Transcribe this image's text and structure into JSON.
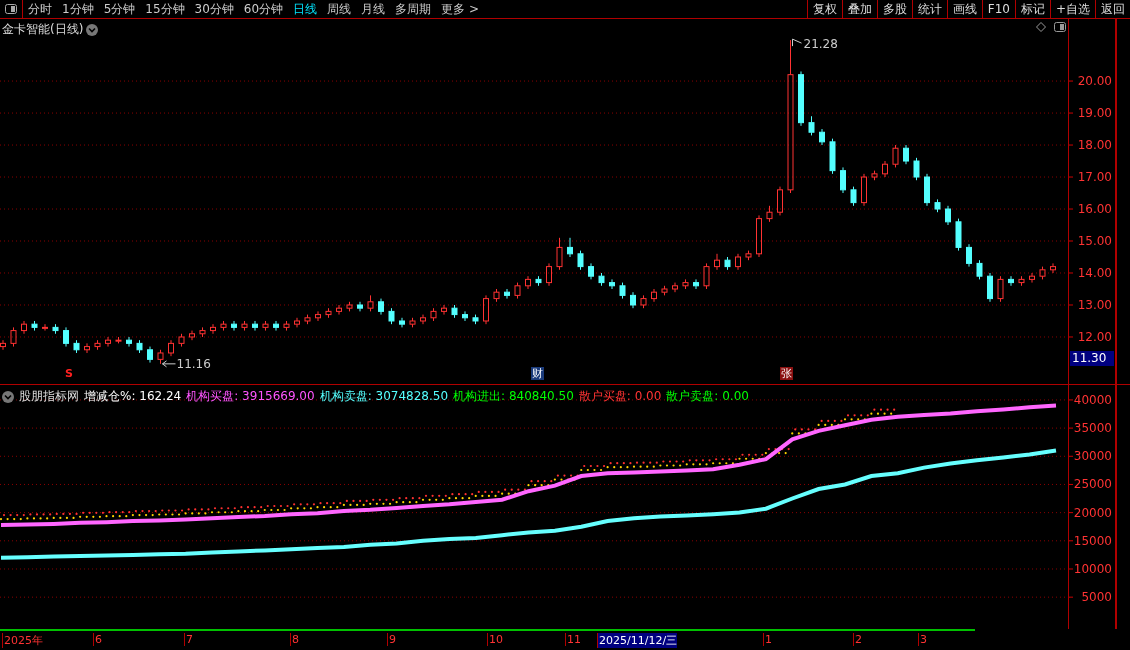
{
  "toolbar": {
    "periods": [
      {
        "label": "分时",
        "selected": false
      },
      {
        "label": "1分钟",
        "selected": false
      },
      {
        "label": "5分钟",
        "selected": false
      },
      {
        "label": "15分钟",
        "selected": false
      },
      {
        "label": "30分钟",
        "selected": false
      },
      {
        "label": "60分钟",
        "selected": false
      },
      {
        "label": "日线",
        "selected": true
      },
      {
        "label": "周线",
        "selected": false
      },
      {
        "label": "月线",
        "selected": false
      },
      {
        "label": "多周期",
        "selected": false
      },
      {
        "label": "更多 >",
        "selected": false
      }
    ],
    "actions": [
      "复权",
      "叠加",
      "多股",
      "统计",
      "画线",
      "F10",
      "标记",
      "+自选",
      "返回"
    ]
  },
  "price_panel": {
    "title": "金卡智能(日线)",
    "high_label": "21.28",
    "low_label": "11.16",
    "chart_data": {
      "type": "candlestick",
      "grid": true,
      "ylim": [
        10.53,
        21.94
      ],
      "yticks": [
        {
          "value": 12,
          "label": "12.00"
        },
        {
          "value": 13,
          "label": "13.00"
        },
        {
          "value": 14,
          "label": "14.00"
        },
        {
          "value": 15,
          "label": "15.00"
        },
        {
          "value": 16,
          "label": "16.00"
        },
        {
          "value": 17,
          "label": "17.00"
        },
        {
          "value": 18,
          "label": "18.00"
        },
        {
          "value": 19,
          "label": "19.00"
        },
        {
          "value": 20,
          "label": "20.00"
        }
      ],
      "ohlc": [
        [
          11.7,
          11.9,
          11.6,
          11.8
        ],
        [
          11.8,
          12.3,
          11.7,
          12.2
        ],
        [
          12.2,
          12.5,
          12.1,
          12.4
        ],
        [
          12.4,
          12.5,
          12.2,
          12.3
        ],
        [
          12.3,
          12.4,
          12.2,
          12.3
        ],
        [
          12.3,
          12.4,
          12.1,
          12.2
        ],
        [
          12.2,
          12.3,
          11.7,
          11.8
        ],
        [
          11.8,
          11.9,
          11.5,
          11.6
        ],
        [
          11.6,
          11.8,
          11.5,
          11.7
        ],
        [
          11.7,
          11.9,
          11.6,
          11.8
        ],
        [
          11.8,
          12.0,
          11.7,
          11.9
        ],
        [
          11.9,
          12.0,
          11.8,
          11.9
        ],
        [
          11.9,
          12.0,
          11.7,
          11.8
        ],
        [
          11.8,
          11.9,
          11.5,
          11.6
        ],
        [
          11.6,
          11.7,
          11.2,
          11.3
        ],
        [
          11.3,
          11.6,
          11.16,
          11.5
        ],
        [
          11.5,
          11.9,
          11.4,
          11.8
        ],
        [
          11.8,
          12.1,
          11.7,
          12.0
        ],
        [
          12.0,
          12.2,
          11.9,
          12.1
        ],
        [
          12.1,
          12.3,
          12.0,
          12.2
        ],
        [
          12.2,
          12.4,
          12.1,
          12.3
        ],
        [
          12.3,
          12.5,
          12.2,
          12.4
        ],
        [
          12.4,
          12.5,
          12.2,
          12.3
        ],
        [
          12.3,
          12.5,
          12.2,
          12.4
        ],
        [
          12.4,
          12.5,
          12.2,
          12.3
        ],
        [
          12.3,
          12.5,
          12.2,
          12.4
        ],
        [
          12.4,
          12.5,
          12.2,
          12.3
        ],
        [
          12.3,
          12.5,
          12.2,
          12.4
        ],
        [
          12.4,
          12.6,
          12.3,
          12.5
        ],
        [
          12.5,
          12.7,
          12.4,
          12.6
        ],
        [
          12.6,
          12.8,
          12.5,
          12.7
        ],
        [
          12.7,
          12.9,
          12.6,
          12.8
        ],
        [
          12.8,
          13.0,
          12.7,
          12.9
        ],
        [
          12.9,
          13.1,
          12.8,
          13.0
        ],
        [
          13.0,
          13.1,
          12.8,
          12.9
        ],
        [
          12.9,
          13.3,
          12.8,
          13.1
        ],
        [
          13.1,
          13.2,
          12.7,
          12.8
        ],
        [
          12.8,
          12.9,
          12.4,
          12.5
        ],
        [
          12.5,
          12.6,
          12.3,
          12.4
        ],
        [
          12.4,
          12.6,
          12.3,
          12.5
        ],
        [
          12.5,
          12.7,
          12.4,
          12.6
        ],
        [
          12.6,
          12.9,
          12.5,
          12.8
        ],
        [
          12.8,
          13.0,
          12.7,
          12.9
        ],
        [
          12.9,
          13.0,
          12.6,
          12.7
        ],
        [
          12.7,
          12.8,
          12.5,
          12.6
        ],
        [
          12.6,
          12.7,
          12.4,
          12.5
        ],
        [
          12.5,
          13.3,
          12.4,
          13.2
        ],
        [
          13.2,
          13.5,
          13.1,
          13.4
        ],
        [
          13.4,
          13.5,
          13.2,
          13.3
        ],
        [
          13.3,
          13.7,
          13.2,
          13.6
        ],
        [
          13.6,
          13.9,
          13.5,
          13.8
        ],
        [
          13.8,
          13.9,
          13.6,
          13.7
        ],
        [
          13.7,
          14.3,
          13.6,
          14.2
        ],
        [
          14.2,
          15.1,
          14.1,
          14.8
        ],
        [
          14.8,
          15.1,
          14.5,
          14.6
        ],
        [
          14.6,
          14.7,
          14.1,
          14.2
        ],
        [
          14.2,
          14.3,
          13.8,
          13.9
        ],
        [
          13.9,
          14.0,
          13.6,
          13.7
        ],
        [
          13.7,
          13.8,
          13.5,
          13.6
        ],
        [
          13.6,
          13.7,
          13.2,
          13.3
        ],
        [
          13.3,
          13.4,
          12.9,
          13.0
        ],
        [
          13.0,
          13.3,
          12.9,
          13.2
        ],
        [
          13.2,
          13.5,
          13.1,
          13.4
        ],
        [
          13.4,
          13.6,
          13.3,
          13.5
        ],
        [
          13.5,
          13.7,
          13.4,
          13.6
        ],
        [
          13.6,
          13.8,
          13.5,
          13.7
        ],
        [
          13.7,
          13.8,
          13.5,
          13.6
        ],
        [
          13.6,
          14.3,
          13.5,
          14.2
        ],
        [
          14.2,
          14.6,
          14.1,
          14.4
        ],
        [
          14.4,
          14.5,
          14.1,
          14.2
        ],
        [
          14.2,
          14.6,
          14.1,
          14.5
        ],
        [
          14.5,
          14.7,
          14.4,
          14.6
        ],
        [
          14.6,
          15.8,
          14.5,
          15.7
        ],
        [
          15.7,
          16.1,
          15.6,
          15.9
        ],
        [
          15.9,
          16.7,
          15.8,
          16.6
        ],
        [
          16.6,
          21.28,
          16.5,
          20.2
        ],
        [
          20.2,
          20.3,
          18.6,
          18.7
        ],
        [
          18.7,
          18.9,
          18.3,
          18.4
        ],
        [
          18.4,
          18.5,
          18.0,
          18.1
        ],
        [
          18.1,
          18.2,
          17.1,
          17.2
        ],
        [
          17.2,
          17.3,
          16.5,
          16.6
        ],
        [
          16.6,
          16.7,
          16.1,
          16.2
        ],
        [
          16.2,
          17.1,
          16.1,
          17.0
        ],
        [
          17.0,
          17.2,
          16.9,
          17.1
        ],
        [
          17.1,
          17.5,
          17.0,
          17.4
        ],
        [
          17.4,
          18.0,
          17.3,
          17.9
        ],
        [
          17.9,
          18.0,
          17.4,
          17.5
        ],
        [
          17.5,
          17.6,
          16.9,
          17.0
        ],
        [
          17.0,
          17.1,
          16.1,
          16.2
        ],
        [
          16.2,
          16.3,
          15.9,
          16.0
        ],
        [
          16.0,
          16.1,
          15.5,
          15.6
        ],
        [
          15.6,
          15.7,
          14.7,
          14.8
        ],
        [
          14.8,
          14.9,
          14.2,
          14.3
        ],
        [
          14.3,
          14.4,
          13.8,
          13.9
        ],
        [
          13.9,
          14.0,
          13.1,
          13.2
        ],
        [
          13.2,
          13.9,
          13.1,
          13.8
        ],
        [
          13.8,
          13.9,
          13.6,
          13.7
        ],
        [
          13.7,
          13.9,
          13.6,
          13.8
        ],
        [
          13.8,
          14.0,
          13.7,
          13.9
        ],
        [
          13.9,
          14.2,
          13.8,
          14.1
        ],
        [
          14.1,
          14.3,
          14.0,
          14.2
        ]
      ]
    },
    "current_price": "11.30",
    "markers": [
      {
        "text": "S",
        "kind": "signal"
      },
      {
        "text": "财",
        "kind": "finance"
      },
      {
        "text": "张",
        "kind": "limit"
      }
    ]
  },
  "indicator_panel": {
    "name": "股朋指标网",
    "legend": [
      {
        "text": "增减仓%: 162.24",
        "color": "#ffffff"
      },
      {
        "text": "机构买盘: 3915669.00",
        "color": "#ff55ff"
      },
      {
        "text": "机构卖盘: 3074828.50",
        "color": "#55ffff"
      },
      {
        "text": "机构进出: 840840.50",
        "color": "#00ff00"
      },
      {
        "text": "散户买盘: 0.00",
        "color": "#ff3333"
      },
      {
        "text": "散户卖盘: 0.00",
        "color": "#00ff00"
      }
    ],
    "chart_data": {
      "type": "line",
      "grid": true,
      "ylim": [
        -650,
        42650
      ],
      "yticks": [
        5000,
        10000,
        15000,
        20000,
        25000,
        30000,
        35000,
        40000
      ],
      "series": [
        {
          "color": "#ff66ff",
          "values": [
            17800,
            17900,
            18000,
            18200,
            18300,
            18500,
            18600,
            18800,
            19000,
            19200,
            19400,
            19700,
            19900,
            20300,
            20500,
            20800,
            21200,
            21500,
            21900,
            22300,
            23800,
            24800,
            26500,
            27000,
            27100,
            27300,
            27500,
            27700,
            28500,
            29500,
            33000,
            34500,
            35500,
            36500,
            37000,
            37300,
            37600,
            38000,
            38300,
            38700,
            39000
          ]
        },
        {
          "color": "#66ffff",
          "values": [
            12000,
            12100,
            12200,
            12300,
            12400,
            12500,
            12600,
            12700,
            12900,
            13100,
            13300,
            13500,
            13700,
            13900,
            14300,
            14500,
            15000,
            15300,
            15500,
            16000,
            16500,
            16800,
            17500,
            18500,
            19000,
            19300,
            19500,
            19700,
            20000,
            20700,
            22500,
            24200,
            25000,
            26500,
            27000,
            28000,
            28700,
            29300,
            29800,
            30300,
            31000
          ]
        }
      ]
    }
  },
  "date_axis": {
    "labels": [
      {
        "text": "2025年",
        "selected": false
      },
      {
        "text": "6",
        "selected": false
      },
      {
        "text": "7",
        "selected": false
      },
      {
        "text": "8",
        "selected": false
      },
      {
        "text": "9",
        "selected": false
      },
      {
        "text": "10",
        "selected": false
      },
      {
        "text": "11",
        "selected": false
      },
      {
        "text": "2025/11/12/三",
        "selected": true
      },
      {
        "text": "1",
        "selected": false
      },
      {
        "text": "2",
        "selected": false
      },
      {
        "text": "3",
        "selected": false
      }
    ]
  }
}
